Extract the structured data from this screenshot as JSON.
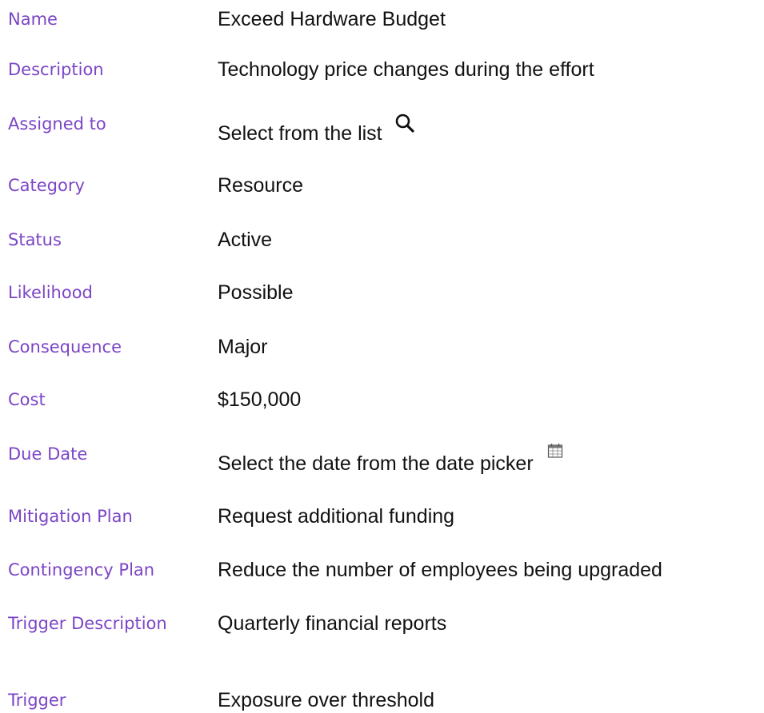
{
  "fields": [
    {
      "label": "Name",
      "value": "Exceed Hardware Budget"
    },
    {
      "label": "Description",
      "value": "Technology price changes during the effort"
    },
    {
      "label": "Assigned to",
      "value": "Select from the list",
      "icon": "search-icon"
    },
    {
      "label": "Category",
      "value": "Resource"
    },
    {
      "label": "Status",
      "value": "Active"
    },
    {
      "label": "Likelihood",
      "value": "Possible"
    },
    {
      "label": "Consequence",
      "value": "Major"
    },
    {
      "label": "Cost",
      "value": "$150,000"
    },
    {
      "label": "Due Date",
      "value": "Select the date from the date picker",
      "icon": "calendar-icon"
    },
    {
      "label": "Mitigation Plan",
      "value": "Request additional funding"
    },
    {
      "label": "Contingency Plan",
      "value": "Reduce the number of employees being upgraded"
    },
    {
      "label": "Trigger Description",
      "value": "Quarterly financial reports"
    },
    {
      "label": "Trigger",
      "value": "Exposure over threshold"
    }
  ],
  "colors": {
    "label": "#7b45c6",
    "value": "#111111",
    "background": "#ffffff"
  }
}
